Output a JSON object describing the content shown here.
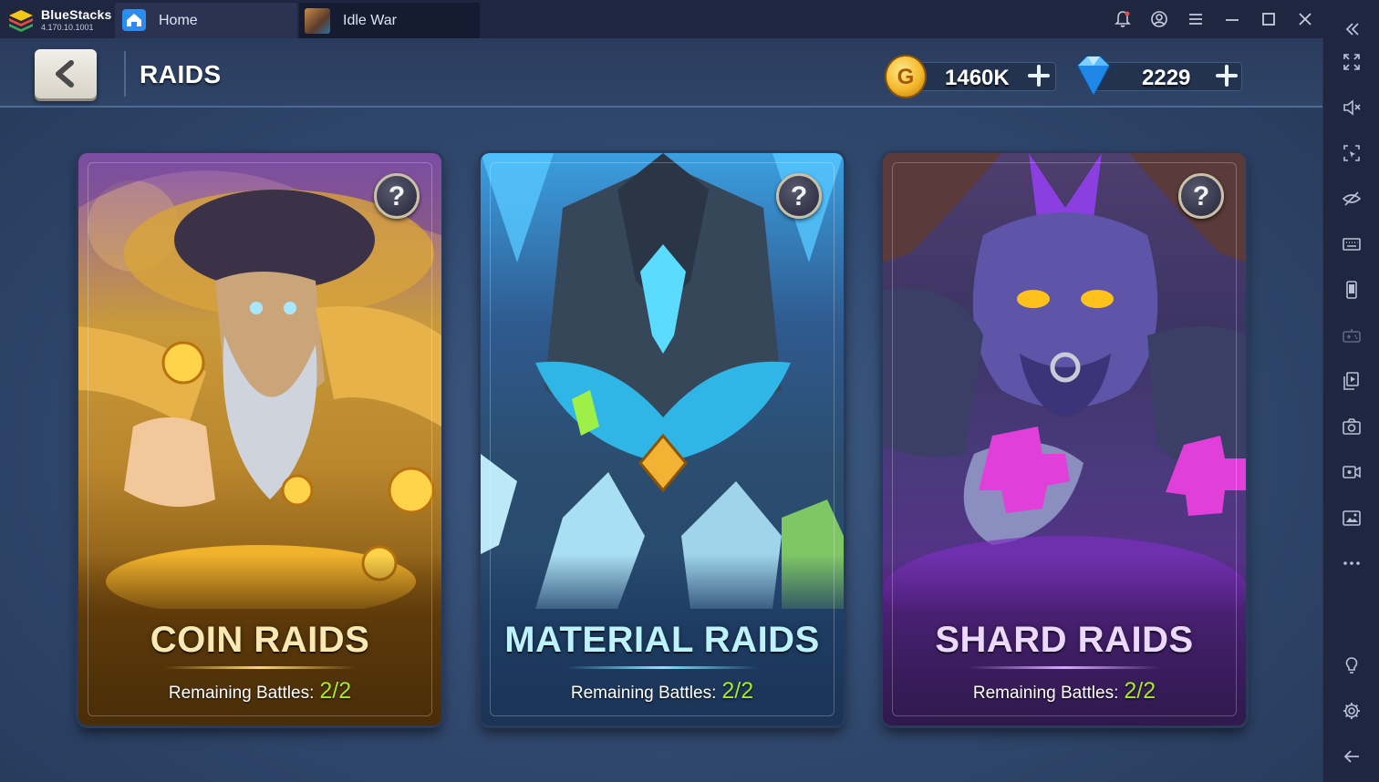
{
  "app": {
    "name": "BlueStacks",
    "version": "4.170.10.1001"
  },
  "tabs": [
    {
      "label": "Home",
      "icon": "home-icon"
    },
    {
      "label": "Idle War",
      "icon": "game-thumbnail-icon"
    }
  ],
  "window_controls": [
    "notification-bell-icon",
    "account-icon",
    "menu-icon",
    "minimize-icon",
    "maximize-icon",
    "close-icon"
  ],
  "side_toolbar": [
    "collapse-sidebar-icon",
    "fullscreen-icon",
    "volume-mute-icon",
    "screen-select-icon",
    "hide-icon",
    "keyboard-icon",
    "phone-rotate-icon",
    "gamepad-icon",
    "multi-instance-icon",
    "screenshot-icon",
    "record-video-icon",
    "media-manager-icon",
    "more-icon",
    "brightness-icon",
    "settings-icon",
    "back-arrow-icon"
  ],
  "game": {
    "page_title": "RAIDS",
    "currency": {
      "gold": "1460K",
      "gold_icon_letter": "G",
      "gems": "2229"
    },
    "help_symbol": "?",
    "cards": [
      {
        "title": "COIN RAIDS",
        "remaining_label": "Remaining Battles:",
        "remaining": "2/2"
      },
      {
        "title": "MATERIAL RAIDS",
        "remaining_label": "Remaining Battles:",
        "remaining": "2/2"
      },
      {
        "title": "SHARD RAIDS",
        "remaining_label": "Remaining Battles:",
        "remaining": "2/2"
      }
    ]
  },
  "colors": {
    "chrome": "#1f2640",
    "remaining_count": "#a7e82e",
    "accent_blue": "#2d8cf0"
  }
}
